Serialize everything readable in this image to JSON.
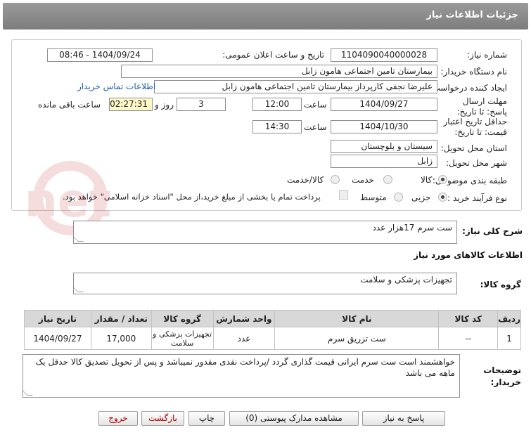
{
  "header": {
    "title": "جزئیات اطلاعات نیاز"
  },
  "form": {
    "need_number_label": "شماره نیاز:",
    "need_number": "1104090040000028",
    "announce_label": "تاریخ و ساعت اعلان عمومی:",
    "announce_value": "1404/09/24 - 08:46",
    "buyer_org_label": "نام دستگاه خریدار:",
    "buyer_org": "بیمارستان تامین اجتماعی هامون  زابل",
    "creator_label": "ایجاد کننده درخواست:",
    "creator": "علیرضا نجفی کارپرداز بیمارستان تامین اجتماعی هامون  زابل",
    "contact_link": "اطلاعات تماس خریدار",
    "deadline_label": "مهلت ارسال پاسخ: تا تاریخ:",
    "deadline_date": "1404/09/27",
    "time_label": "ساعت",
    "deadline_time": "12:00",
    "days_value": "3",
    "days_label": "روز و",
    "remaining_time": "02:27:31",
    "remaining_label": "ساعت باقی مانده",
    "min_validity_label": "حداقل تاریخ اعتبار قیمت: تا تاریخ:",
    "validity_date": "1404/10/30",
    "validity_time": "14:30",
    "province_label": "استان محل تحویل:",
    "province": "سیستان و بلوچستان",
    "city_label": "شهر محل تحویل:",
    "city": "زابل",
    "category_label": "طبقه بندی موضوعی:",
    "category_options": [
      "کالا",
      "خدمت",
      "کالا/خدمت"
    ],
    "process_label": "نوع فرآیند خرید :",
    "process_options": [
      "جزیی",
      "متوسط"
    ],
    "treasury_note": "پرداخت تمام یا بخشی از مبلغ خرید،از محل \"اسناد خزانه اسلامی\" خواهد بود."
  },
  "summary": {
    "label": "شرح کلی نیاز:",
    "text": "ست سرم 17هزار عدد"
  },
  "goods_info_title": "اطلاعات کالاهای مورد نیاز",
  "goods_group": {
    "label": "گروه کالا:",
    "value": "تجهیزات پزشکی و سلامت"
  },
  "table": {
    "headers": [
      "ردیف",
      "کد کالا",
      "نام کالا",
      "واحد شمارش",
      "گروه کالا",
      "تعداد / مقدار",
      "تاریخ نیاز"
    ],
    "rows": [
      [
        "1",
        "--",
        "ست تزریق سرم",
        "عدد",
        "تجهیزات پزشکی و سلامت",
        "17,000",
        "1404/09/27"
      ]
    ]
  },
  "buyer_notes": {
    "label": "توضیحات خریدار:",
    "text": "خواهشمند است ست سرم ایرانی قیمت گذاری گردد /پرداخت نقدی مقدور نمیباشد و پس از تحویل تصدیق کالا حدقل یک ماهه می باشد"
  },
  "buttons": {
    "reply": "پاسخ به نیاز",
    "attachments": "مشاهده مدارک پیوستی (0)",
    "print": "چاپ",
    "back": "بازگشت",
    "exit": "خروج"
  },
  "watermark": {
    "text": "AriaTender.net"
  },
  "colors": {
    "titlebar": "#8a8a8a",
    "link": "#1a5fb4",
    "yellow_box": "#fdf8c8",
    "table_header": "#d8d8d8",
    "danger": "#b00000"
  }
}
